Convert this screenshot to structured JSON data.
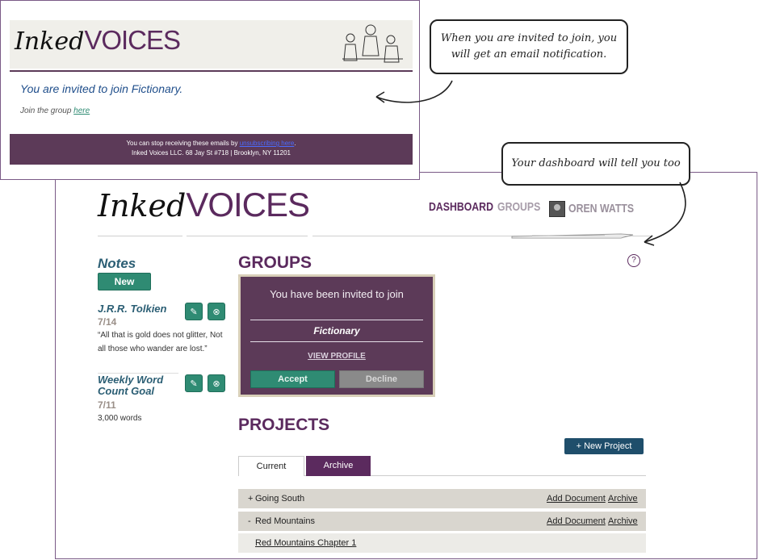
{
  "email": {
    "logo_inked": "Inked",
    "logo_voices": "VOICES",
    "headline": "You are invited to join Fictionary.",
    "join_prefix": "Join the group ",
    "join_link": "here",
    "footer_prefix": "You can stop receiving these emails by ",
    "footer_link": "unsubscribing here",
    "footer_suffix": ".",
    "footer_address": "Inked Voices LLC. 68 Jay St #718 | Brooklyn, NY 11201"
  },
  "callouts": {
    "email_note": "When you are invited to join, you will get an email notification.",
    "dashboard_note": "Your dashboard will tell you too"
  },
  "header": {
    "logo_inked": "Inked",
    "logo_voices": "VOICES",
    "nav": {
      "dashboard": "DASHBOARD",
      "groups": "GROUPS",
      "user": "OREN WATTS"
    },
    "help": "?"
  },
  "notes": {
    "title": "Notes",
    "new_label": "New",
    "items": [
      {
        "title": "J.R.R. Tolkien",
        "date": "7/14",
        "body": "“All that is gold does not glitter, Not all those who wander are lost.”"
      },
      {
        "title": "Weekly Word Count  Goal",
        "date": "7/11",
        "body": "3,000 words"
      }
    ]
  },
  "groups": {
    "heading": "GROUPS",
    "invite_text": "You have been invited to join",
    "group_name": "Fictionary",
    "view_profile": "VIEW PROFILE",
    "accept": "Accept",
    "decline": "Decline"
  },
  "projects": {
    "heading": "PROJECTS",
    "new_project": "+ New Project",
    "tabs": [
      "Current",
      "Archive"
    ],
    "rows": [
      {
        "toggle": "+",
        "name": "Going South",
        "add_doc": "Add Document",
        "archive": "Archive"
      },
      {
        "toggle": "-",
        "name": "Red Mountains",
        "add_doc": "Add Document",
        "archive": "Archive"
      }
    ],
    "sub_item": "Red Mountains Chapter 1"
  },
  "colors": {
    "purple": "#5b2a5e",
    "teal": "#2f8b73",
    "navy": "#1f4e6b",
    "footer": "#5c3a58"
  }
}
